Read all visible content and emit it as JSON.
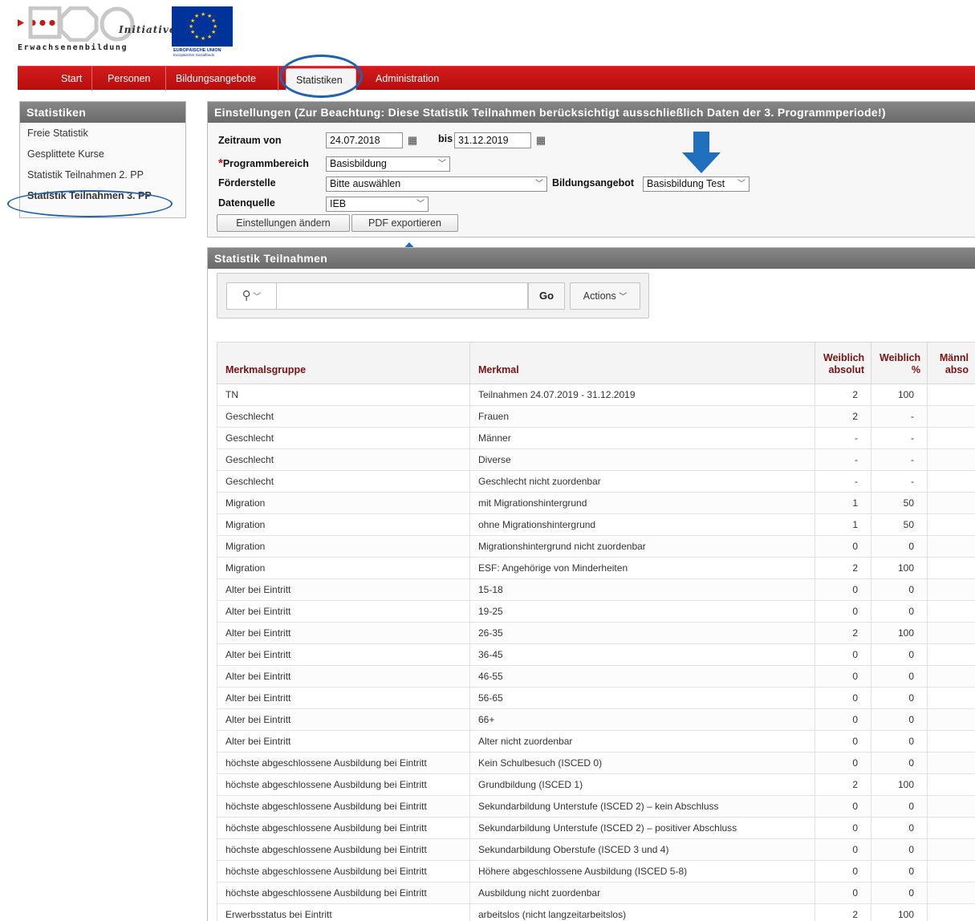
{
  "logo": {
    "initiative": "Initiative",
    "erwachsenenbildung": "Erwachsenenbildung",
    "eu_line1": "EUROPÄISCHE UNION",
    "eu_line2": "Europäischer Sozialfonds"
  },
  "nav": {
    "items": [
      {
        "label": "Start"
      },
      {
        "label": "Personen"
      },
      {
        "label": "Bildungsangebote"
      },
      {
        "label": "Statistiken"
      },
      {
        "label": "Administration"
      }
    ]
  },
  "sidebar": {
    "title": "Statistiken",
    "items": [
      {
        "label": "Freie Statistik"
      },
      {
        "label": "Gesplittete Kurse"
      },
      {
        "label": "Statistik Teilnahmen 2. PP"
      },
      {
        "label": "Statistik Teilnahmen 3. PP"
      }
    ]
  },
  "settings": {
    "title": "Einstellungen (Zur Beachtung: Diese Statistik Teilnahmen berücksichtigt ausschließlich Daten der 3. Programmperiode!)",
    "zeitraum_label": "Zeitraum von",
    "date_from": "24.07.2018",
    "bis_label": "bis",
    "date_to": "31.12.2019",
    "programmbereich_label": "Programmbereich",
    "programmbereich_value": "Basisbildung",
    "foerderstelle_label": "Förderstelle",
    "foerderstelle_value": "Bitte auswählen",
    "bildungsangebot_label": "Bildungsangebot",
    "bildungsangebot_value": "Basisbildung Test",
    "datenquelle_label": "Datenquelle",
    "datenquelle_value": "IEB",
    "btn_change": "Einstellungen ändern",
    "btn_pdf": "PDF exportieren"
  },
  "stats": {
    "title": "Statistik Teilnahmen",
    "go_label": "Go",
    "actions_label": "Actions",
    "columns": [
      "Merkmalsgruppe",
      "Merkmal",
      "Weiblich absolut",
      "Weiblich %",
      "Männl abso"
    ],
    "rows": [
      {
        "gruppe": "TN",
        "merkmal": "Teilnahmen 24.07.2019 - 31.12.2019",
        "w_abs": "2",
        "w_pct": "100"
      },
      {
        "gruppe": "Geschlecht",
        "merkmal": "Frauen",
        "w_abs": "2",
        "w_pct": "-"
      },
      {
        "gruppe": "Geschlecht",
        "merkmal": "Männer",
        "w_abs": "-",
        "w_pct": "-"
      },
      {
        "gruppe": "Geschlecht",
        "merkmal": "Diverse",
        "w_abs": "-",
        "w_pct": "-"
      },
      {
        "gruppe": "Geschlecht",
        "merkmal": "Geschlecht nicht zuordenbar",
        "w_abs": "-",
        "w_pct": "-"
      },
      {
        "gruppe": "Migration",
        "merkmal": "mit Migrationshintergrund",
        "w_abs": "1",
        "w_pct": "50"
      },
      {
        "gruppe": "Migration",
        "merkmal": "ohne Migrationshintergrund",
        "w_abs": "1",
        "w_pct": "50"
      },
      {
        "gruppe": "Migration",
        "merkmal": "Migrationshintergrund nicht zuordenbar",
        "w_abs": "0",
        "w_pct": "0"
      },
      {
        "gruppe": "Migration",
        "merkmal": "ESF: Angehörige von Minderheiten",
        "w_abs": "2",
        "w_pct": "100"
      },
      {
        "gruppe": "Alter bei Eintritt",
        "merkmal": "15-18",
        "w_abs": "0",
        "w_pct": "0"
      },
      {
        "gruppe": "Alter bei Eintritt",
        "merkmal": "19-25",
        "w_abs": "0",
        "w_pct": "0"
      },
      {
        "gruppe": "Alter bei Eintritt",
        "merkmal": "26-35",
        "w_abs": "2",
        "w_pct": "100"
      },
      {
        "gruppe": "Alter bei Eintritt",
        "merkmal": "36-45",
        "w_abs": "0",
        "w_pct": "0"
      },
      {
        "gruppe": "Alter bei Eintritt",
        "merkmal": "46-55",
        "w_abs": "0",
        "w_pct": "0"
      },
      {
        "gruppe": "Alter bei Eintritt",
        "merkmal": "56-65",
        "w_abs": "0",
        "w_pct": "0"
      },
      {
        "gruppe": "Alter bei Eintritt",
        "merkmal": "66+",
        "w_abs": "0",
        "w_pct": "0"
      },
      {
        "gruppe": "Alter bei Eintritt",
        "merkmal": "Alter nicht zuordenbar",
        "w_abs": "0",
        "w_pct": "0"
      },
      {
        "gruppe": "höchste abgeschlossene Ausbildung bei Eintritt",
        "merkmal": "Kein Schulbesuch (ISCED 0)",
        "w_abs": "0",
        "w_pct": "0"
      },
      {
        "gruppe": "höchste abgeschlossene Ausbildung bei Eintritt",
        "merkmal": "Grundbildung (ISCED 1)",
        "w_abs": "2",
        "w_pct": "100"
      },
      {
        "gruppe": "höchste abgeschlossene Ausbildung bei Eintritt",
        "merkmal": "Sekundarbildung Unterstufe (ISCED 2) – kein Abschluss",
        "w_abs": "0",
        "w_pct": "0"
      },
      {
        "gruppe": "höchste abgeschlossene Ausbildung bei Eintritt",
        "merkmal": "Sekundarbildung Unterstufe (ISCED 2) – positiver Abschluss",
        "w_abs": "0",
        "w_pct": "0"
      },
      {
        "gruppe": "höchste abgeschlossene Ausbildung bei Eintritt",
        "merkmal": "Sekundarbildung Oberstufe (ISCED 3 und 4)",
        "w_abs": "0",
        "w_pct": "0"
      },
      {
        "gruppe": "höchste abgeschlossene Ausbildung bei Eintritt",
        "merkmal": "Höhere abgeschlossene Ausbildung (ISCED 5-8)",
        "w_abs": "0",
        "w_pct": "0"
      },
      {
        "gruppe": "höchste abgeschlossene Ausbildung bei Eintritt",
        "merkmal": "Ausbildung nicht zuordenbar",
        "w_abs": "0",
        "w_pct": "0"
      },
      {
        "gruppe": "Erwerbsstatus bei Eintritt",
        "merkmal": "arbeitslos (nicht langzeitarbeitslos)",
        "w_abs": "2",
        "w_pct": "100"
      }
    ]
  },
  "colors": {
    "nav_red": "#c41414",
    "header_dark_red": "#7a1212",
    "annotation_blue": "#1f63b0",
    "eu_blue": "#003399"
  }
}
